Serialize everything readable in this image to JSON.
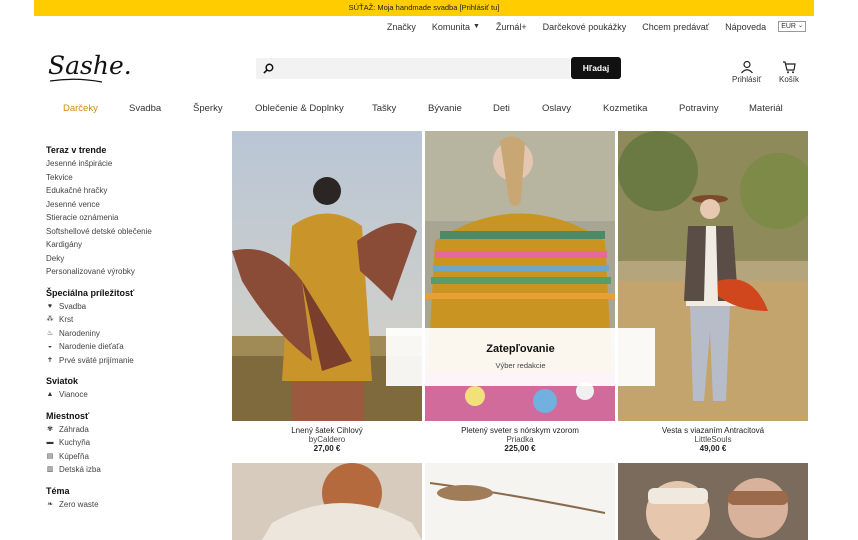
{
  "promo_banner": "SÚŤAŽ: Moja handmade svadba [Prihlásiť tu]",
  "top_nav": {
    "items": [
      "Značky",
      "Komunita",
      "Žurnál+",
      "Darčekové poukážky",
      "Chcem predávať",
      "Nápoveda"
    ],
    "currency": "EUR"
  },
  "logo_text": "Sashe.sk",
  "search": {
    "placeholder": "",
    "button_label": "Hľadaj"
  },
  "account": {
    "login_label": "Prihlásiť",
    "cart_label": "Košík"
  },
  "categories": [
    "Darčeky",
    "Svadba",
    "Šperky",
    "Oblečenie & Doplnky",
    "Tašky",
    "Bývanie",
    "Deti",
    "Oslavy",
    "Kozmetika",
    "Potraviny",
    "Materiál"
  ],
  "sidebar": {
    "trending": {
      "title": "Teraz v trende",
      "items": [
        "Jesenné inšpirácie",
        "Tekvice",
        "Edukačné hračky",
        "Jesenné vence",
        "Stieracie oznámenia",
        "Softshellové detské oblečenie",
        "Kardigány",
        "Deky",
        "Personalizované výrobky"
      ]
    },
    "occasions": {
      "title": "Špeciálna príležitosť",
      "items": [
        {
          "label": "Svadba",
          "icon": "heart-icon"
        },
        {
          "label": "Krst",
          "icon": "family-icon"
        },
        {
          "label": "Narodeniny",
          "icon": "cake-icon"
        },
        {
          "label": "Narodenie dieťaťa",
          "icon": "stroller-icon"
        },
        {
          "label": "Prvé sväté prijímanie",
          "icon": "cross-icon"
        }
      ]
    },
    "holiday": {
      "title": "Sviatok",
      "items": [
        {
          "label": "Vianoce",
          "icon": "tree-icon"
        }
      ]
    },
    "room": {
      "title": "Miestnosť",
      "items": [
        {
          "label": "Záhrada",
          "icon": "plant-icon"
        },
        {
          "label": "Kuchyňa",
          "icon": "pot-icon"
        },
        {
          "label": "Kúpeľňa",
          "icon": "bath-icon"
        },
        {
          "label": "Detská izba",
          "icon": "crib-icon"
        }
      ]
    },
    "theme": {
      "title": "Téma",
      "items": [
        {
          "label": "Zero waste",
          "icon": "leaf-icon"
        }
      ]
    }
  },
  "feature": {
    "title": "Zatepľovanie",
    "subtitle": "Výber redakcie"
  },
  "products": [
    {
      "name": "Lnený šatek Cihlový",
      "seller": "byCaldero",
      "price": "27,00 €"
    },
    {
      "name": "Pletený sveter s nórskym vzorom",
      "seller": "Priadka",
      "price": "225,00 €"
    },
    {
      "name": "Vesta s viazaním Antracitová",
      "seller": "LittleSouls",
      "price": "49,00 €"
    }
  ],
  "colors": {
    "accent": "#d28a12",
    "promo": "#ffcc00",
    "button": "#111111"
  }
}
